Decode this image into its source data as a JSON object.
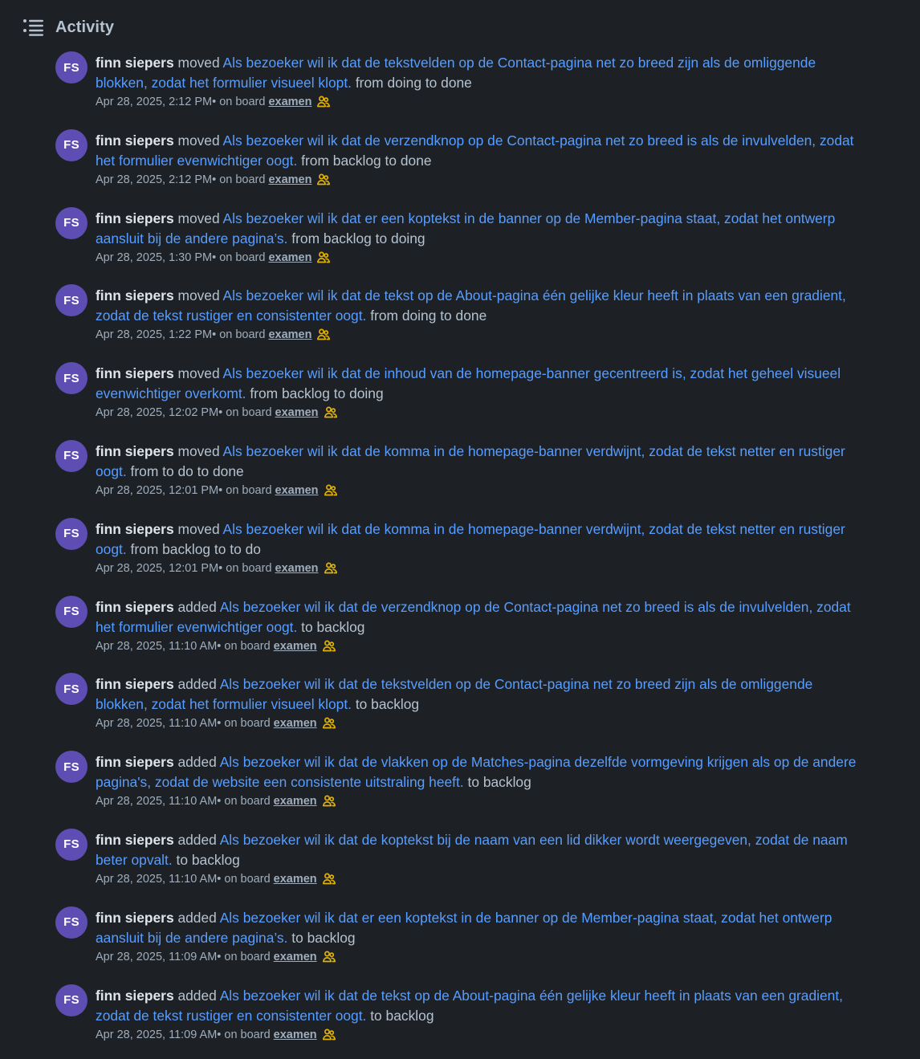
{
  "header": {
    "title": "Activity",
    "icon": "activity-list-icon"
  },
  "colors": {
    "background": "#1d2125",
    "link": "#579dff",
    "avatar": "#5e4db2",
    "board_icon": "#e2b203"
  },
  "activities": [
    {
      "initials": "FS",
      "member": "finn siepers",
      "action": " moved ",
      "card": "Als bezoeker wil ik dat de tekstvelden op de Contact-pagina net zo breed zijn als de omliggende blokken, zodat het formulier visueel klopt.",
      "detail": " from doing to done",
      "time": "Apr 28, 2025, 2:12 PM",
      "on_board": " • on board",
      "board": "examen"
    },
    {
      "initials": "FS",
      "member": "finn siepers",
      "action": " moved ",
      "card": "Als bezoeker wil ik dat de verzendknop op de Contact-pagina net zo breed is als de invulvelden, zodat het formulier evenwichtiger oogt.",
      "detail": " from backlog to done",
      "time": "Apr 28, 2025, 2:12 PM",
      "on_board": " • on board",
      "board": "examen"
    },
    {
      "initials": "FS",
      "member": "finn siepers",
      "action": " moved ",
      "card": "Als bezoeker wil ik dat er een koptekst in de banner op de Member-pagina staat, zodat het ontwerp aansluit bij de andere pagina’s.",
      "detail": " from backlog to doing",
      "time": "Apr 28, 2025, 1:30 PM",
      "on_board": " • on board",
      "board": "examen"
    },
    {
      "initials": "FS",
      "member": "finn siepers",
      "action": " moved ",
      "card": "Als bezoeker wil ik dat de tekst op de About-pagina één gelijke kleur heeft in plaats van een gradient, zodat de tekst rustiger en consistenter oogt.",
      "detail": " from doing to done",
      "time": "Apr 28, 2025, 1:22 PM",
      "on_board": " • on board",
      "board": "examen"
    },
    {
      "initials": "FS",
      "member": "finn siepers",
      "action": " moved ",
      "card": "Als bezoeker wil ik dat de inhoud van de homepage-banner gecentreerd is, zodat het geheel visueel evenwichtiger overkomt.",
      "detail": " from backlog to doing",
      "time": "Apr 28, 2025, 12:02 PM",
      "on_board": " • on board",
      "board": "examen"
    },
    {
      "initials": "FS",
      "member": "finn siepers",
      "action": " moved ",
      "card": "Als bezoeker wil ik dat de komma in de homepage-banner verdwijnt, zodat de tekst netter en rustiger oogt.",
      "detail": " from to do to done",
      "time": "Apr 28, 2025, 12:01 PM",
      "on_board": " • on board",
      "board": "examen"
    },
    {
      "initials": "FS",
      "member": "finn siepers",
      "action": " moved ",
      "card": "Als bezoeker wil ik dat de komma in de homepage-banner verdwijnt, zodat de tekst netter en rustiger oogt.",
      "detail": " from backlog to to do",
      "time": "Apr 28, 2025, 12:01 PM",
      "on_board": " • on board",
      "board": "examen"
    },
    {
      "initials": "FS",
      "member": "finn siepers",
      "action": " added ",
      "card": "Als bezoeker wil ik dat de verzendknop op de Contact-pagina net zo breed is als de invulvelden, zodat het formulier evenwichtiger oogt.",
      "detail": " to backlog",
      "time": "Apr 28, 2025, 11:10 AM",
      "on_board": " • on board",
      "board": "examen"
    },
    {
      "initials": "FS",
      "member": "finn siepers",
      "action": " added ",
      "card": "Als bezoeker wil ik dat de tekstvelden op de Contact-pagina net zo breed zijn als de omliggende blokken, zodat het formulier visueel klopt.",
      "detail": " to backlog",
      "time": "Apr 28, 2025, 11:10 AM",
      "on_board": " • on board",
      "board": "examen"
    },
    {
      "initials": "FS",
      "member": "finn siepers",
      "action": " added ",
      "card": "Als bezoeker wil ik dat de vlakken op de Matches-pagina dezelfde vormgeving krijgen als op de andere pagina's, zodat de website een consistente uitstraling heeft.",
      "detail": " to backlog",
      "time": "Apr 28, 2025, 11:10 AM",
      "on_board": " • on board",
      "board": "examen"
    },
    {
      "initials": "FS",
      "member": "finn siepers",
      "action": " added ",
      "card": "Als bezoeker wil ik dat de koptekst bij de naam van een lid dikker wordt weergegeven, zodat de naam beter opvalt.",
      "detail": " to backlog",
      "time": "Apr 28, 2025, 11:10 AM",
      "on_board": " • on board",
      "board": "examen"
    },
    {
      "initials": "FS",
      "member": "finn siepers",
      "action": " added ",
      "card": "Als bezoeker wil ik dat er een koptekst in de banner op de Member-pagina staat, zodat het ontwerp aansluit bij de andere pagina’s.",
      "detail": " to backlog",
      "time": "Apr 28, 2025, 11:09 AM",
      "on_board": " • on board",
      "board": "examen"
    },
    {
      "initials": "FS",
      "member": "finn siepers",
      "action": " added ",
      "card": "Als bezoeker wil ik dat de tekst op de About-pagina één gelijke kleur heeft in plaats van een gradient, zodat de tekst rustiger en consistenter oogt.",
      "detail": " to backlog",
      "time": "Apr 28, 2025, 11:09 AM",
      "on_board": " • on board",
      "board": "examen"
    }
  ]
}
